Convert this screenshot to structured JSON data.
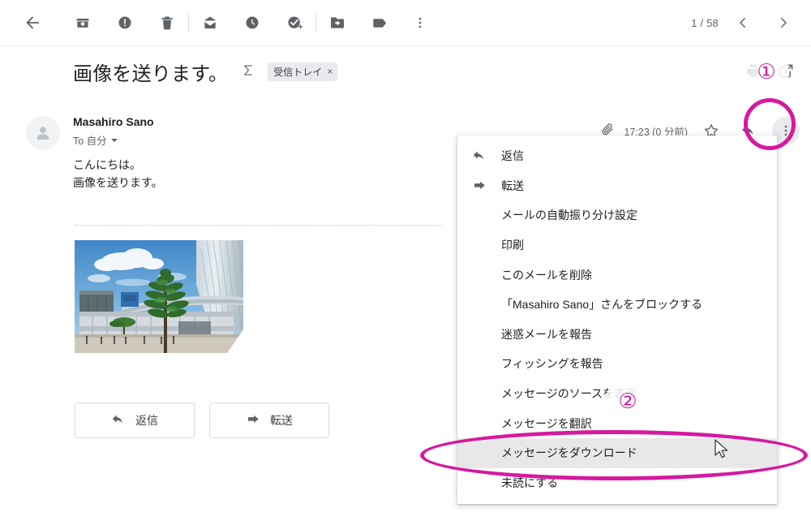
{
  "toolbar": {
    "back_label": "back-to-inbox",
    "buttons": [
      {
        "name": "back-arrow-icon",
        "label": "戻る"
      },
      {
        "name": "archive-icon",
        "label": "アーカイブ"
      },
      {
        "name": "report-spam-icon",
        "label": "迷惑メールを報告"
      },
      {
        "name": "delete-icon",
        "label": "削除"
      },
      {
        "name": "mark-unread-icon",
        "label": "未読にする"
      },
      {
        "name": "snooze-clock-icon",
        "label": "スヌーズ"
      },
      {
        "name": "add-to-tasks-icon",
        "label": "ToDo リストに追加"
      },
      {
        "name": "move-to-folder-icon",
        "label": "移動"
      },
      {
        "name": "labels-tag-icon",
        "label": "ラベル"
      },
      {
        "name": "more-options-icon",
        "label": "その他"
      }
    ],
    "pagination": "1 / 58",
    "prev_label": "前へ",
    "next_label": "次へ"
  },
  "subject": {
    "text": "画像を送ります。",
    "thread_icon": "Σ",
    "label_chip": "受信トレイ",
    "label_chip_remove": "×",
    "print_icon_name": "print-icon",
    "open_new_window_icon_name": "open-in-new-window-icon"
  },
  "message": {
    "sender_name": "Masahiro Sano",
    "recipient": "To 自分",
    "timestamp": "17:23 (0 分前)",
    "attachment_icon": "paperclip-icon",
    "star_icon": "star-icon",
    "reply_icon": "reply-icon",
    "more_icon": "more-vertical-icon",
    "body_lines": [
      "こんにちは。",
      "画像を送ります。"
    ],
    "attachment_image_alt": "駅前広場の写真"
  },
  "bottom_actions": [
    {
      "name": "reply-button",
      "label": "返信",
      "icon": "reply-icon"
    },
    {
      "name": "forward-button",
      "label": "転送",
      "icon": "forward-icon"
    }
  ],
  "menu": {
    "items": [
      {
        "name": "menu-item-reply",
        "label": "返信",
        "icon": "reply-icon",
        "highlight": false
      },
      {
        "name": "menu-item-forward",
        "label": "転送",
        "icon": "forward-icon",
        "highlight": false
      },
      {
        "name": "menu-item-filter-messages",
        "label": "メールの自動振り分け設定",
        "icon": "",
        "highlight": false
      },
      {
        "name": "menu-item-print",
        "label": "印刷",
        "icon": "",
        "highlight": false
      },
      {
        "name": "menu-item-delete-this-message",
        "label": "このメールを削除",
        "icon": "",
        "highlight": false
      },
      {
        "name": "menu-item-block-sender",
        "label": "「Masahiro Sano」さんをブロックする",
        "icon": "",
        "highlight": false
      },
      {
        "name": "menu-item-report-spam",
        "label": "迷惑メールを報告",
        "icon": "",
        "highlight": false
      },
      {
        "name": "menu-item-report-phishing",
        "label": "フィッシングを報告",
        "icon": "",
        "highlight": false
      },
      {
        "name": "menu-item-show-original",
        "label": "メッセージのソースを表示",
        "icon": "",
        "highlight": false
      },
      {
        "name": "menu-item-translate-message",
        "label": "メッセージを翻訳",
        "icon": "",
        "highlight": false
      },
      {
        "name": "menu-item-download-message",
        "label": "メッセージをダウンロード",
        "icon": "",
        "highlight": true
      },
      {
        "name": "menu-item-mark-unread",
        "label": "未読にする",
        "icon": "",
        "highlight": false
      }
    ]
  },
  "annotations": {
    "color": "#d6199f",
    "badge_1": "①",
    "badge_2": "②",
    "circled_target_1": "more-vertical-icon",
    "circled_target_2": "menu-item-download-message"
  }
}
